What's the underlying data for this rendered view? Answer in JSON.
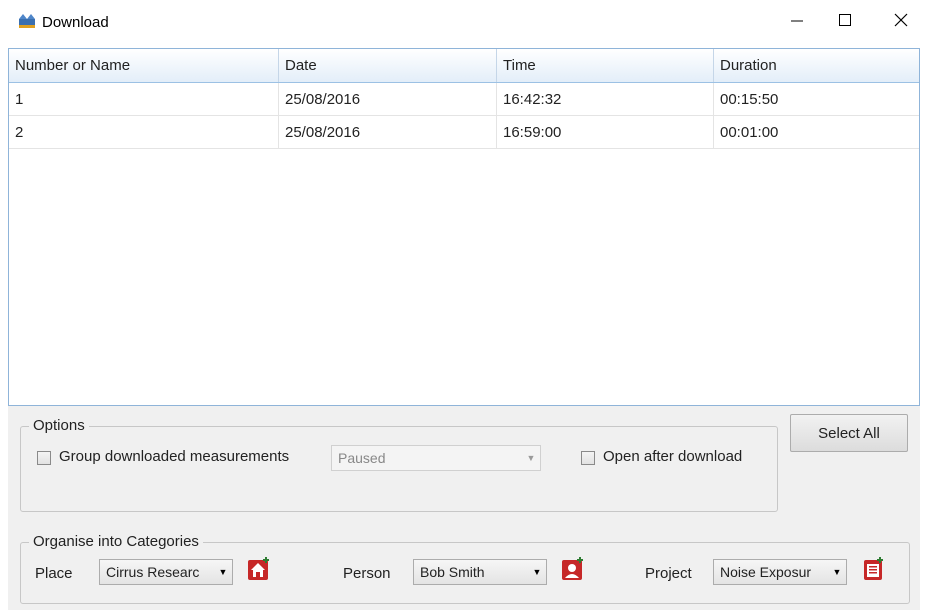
{
  "window": {
    "title": "Download",
    "icon": "download-app-icon",
    "controls": {
      "minimize_icon": "minimize-icon",
      "maximize_icon": "maximize-icon",
      "close_icon": "close-icon"
    }
  },
  "table": {
    "columns": [
      "Number or Name",
      "Date",
      "Time",
      "Duration"
    ],
    "rows": [
      {
        "name": "1",
        "date": "25/08/2016",
        "time": "16:42:32",
        "duration": "00:15:50"
      },
      {
        "name": "2",
        "date": "25/08/2016",
        "time": "16:59:00",
        "duration": "00:01:00"
      }
    ]
  },
  "options": {
    "group_label": "Options",
    "group_checkbox_label": "Group downloaded measurements",
    "group_checkbox_checked": false,
    "group_mode": "Paused",
    "open_after_label": "Open after download",
    "open_after_checked": false
  },
  "select_all_label": "Select All",
  "categories": {
    "group_label": "Organise into Categories",
    "place_label": "Place",
    "place_value": "Cirrus Researc",
    "place_add_icon": "add-place-icon",
    "person_label": "Person",
    "person_value": "Bob Smith",
    "person_add_icon": "add-person-icon",
    "project_label": "Project",
    "project_value": "Noise Exposur",
    "project_add_icon": "add-project-icon"
  },
  "colors": {
    "header_gradient_bottom": "#e3eef9",
    "grid_border": "#8fb4d9",
    "panel_background": "#f0f0f0",
    "icon_red": "#c62828"
  }
}
